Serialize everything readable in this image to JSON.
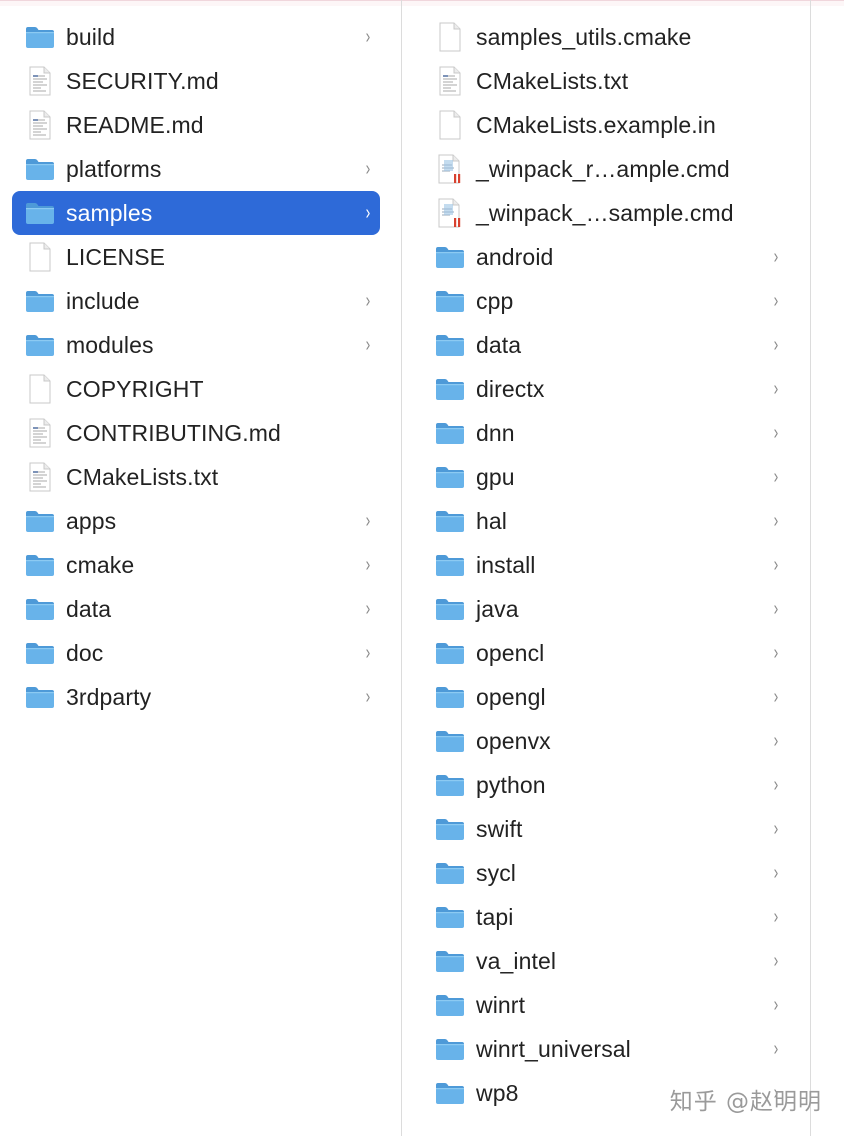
{
  "colors": {
    "selection": "#2e6ad8",
    "folder_body": "#68b3ea",
    "folder_tab": "#4e9ad8",
    "text": "#222222",
    "chevron": "#8c8c8c"
  },
  "column1": {
    "items": [
      {
        "name": "build",
        "icon": "folder-icon",
        "type": "folder"
      },
      {
        "name": "SECURITY.md",
        "icon": "text-document-icon",
        "type": "text"
      },
      {
        "name": "README.md",
        "icon": "text-document-icon",
        "type": "text"
      },
      {
        "name": "platforms",
        "icon": "folder-icon",
        "type": "folder"
      },
      {
        "name": "samples",
        "icon": "folder-icon",
        "type": "folder",
        "selected": true
      },
      {
        "name": "LICENSE",
        "icon": "blank-document-icon",
        "type": "blank"
      },
      {
        "name": "include",
        "icon": "folder-icon",
        "type": "folder"
      },
      {
        "name": "modules",
        "icon": "folder-icon",
        "type": "folder"
      },
      {
        "name": "COPYRIGHT",
        "icon": "blank-document-icon",
        "type": "blank"
      },
      {
        "name": "CONTRIBUTING.md",
        "icon": "text-document-icon",
        "type": "text"
      },
      {
        "name": "CMakeLists.txt",
        "icon": "text-document-icon",
        "type": "text"
      },
      {
        "name": "apps",
        "icon": "folder-icon",
        "type": "folder"
      },
      {
        "name": "cmake",
        "icon": "folder-icon",
        "type": "folder"
      },
      {
        "name": "data",
        "icon": "folder-icon",
        "type": "folder"
      },
      {
        "name": "doc",
        "icon": "folder-icon",
        "type": "folder"
      },
      {
        "name": "3rdparty",
        "icon": "folder-icon",
        "type": "folder"
      }
    ]
  },
  "column2": {
    "items": [
      {
        "name": "samples_utils.cmake",
        "icon": "blank-document-icon",
        "type": "blank"
      },
      {
        "name": "CMakeLists.txt",
        "icon": "text-document-icon",
        "type": "text"
      },
      {
        "name": "CMakeLists.example.in",
        "icon": "blank-document-icon",
        "type": "blank"
      },
      {
        "name": "_winpack_r…ample.cmd",
        "icon": "script-document-icon",
        "type": "script"
      },
      {
        "name": "_winpack_…sample.cmd",
        "icon": "script-document-icon",
        "type": "script"
      },
      {
        "name": "android",
        "icon": "folder-icon",
        "type": "folder"
      },
      {
        "name": "cpp",
        "icon": "folder-icon",
        "type": "folder"
      },
      {
        "name": "data",
        "icon": "folder-icon",
        "type": "folder"
      },
      {
        "name": "directx",
        "icon": "folder-icon",
        "type": "folder"
      },
      {
        "name": "dnn",
        "icon": "folder-icon",
        "type": "folder"
      },
      {
        "name": "gpu",
        "icon": "folder-icon",
        "type": "folder"
      },
      {
        "name": "hal",
        "icon": "folder-icon",
        "type": "folder"
      },
      {
        "name": "install",
        "icon": "folder-icon",
        "type": "folder"
      },
      {
        "name": "java",
        "icon": "folder-icon",
        "type": "folder"
      },
      {
        "name": "opencl",
        "icon": "folder-icon",
        "type": "folder"
      },
      {
        "name": "opengl",
        "icon": "folder-icon",
        "type": "folder"
      },
      {
        "name": "openvx",
        "icon": "folder-icon",
        "type": "folder"
      },
      {
        "name": "python",
        "icon": "folder-icon",
        "type": "folder"
      },
      {
        "name": "swift",
        "icon": "folder-icon",
        "type": "folder"
      },
      {
        "name": "sycl",
        "icon": "folder-icon",
        "type": "folder"
      },
      {
        "name": "tapi",
        "icon": "folder-icon",
        "type": "folder"
      },
      {
        "name": "va_intel",
        "icon": "folder-icon",
        "type": "folder"
      },
      {
        "name": "winrt",
        "icon": "folder-icon",
        "type": "folder"
      },
      {
        "name": "winrt_universal",
        "icon": "folder-icon",
        "type": "folder"
      },
      {
        "name": "wp8",
        "icon": "folder-icon",
        "type": "folder"
      }
    ]
  },
  "chevron_glyph": "›",
  "watermark": "知乎 @赵明明"
}
